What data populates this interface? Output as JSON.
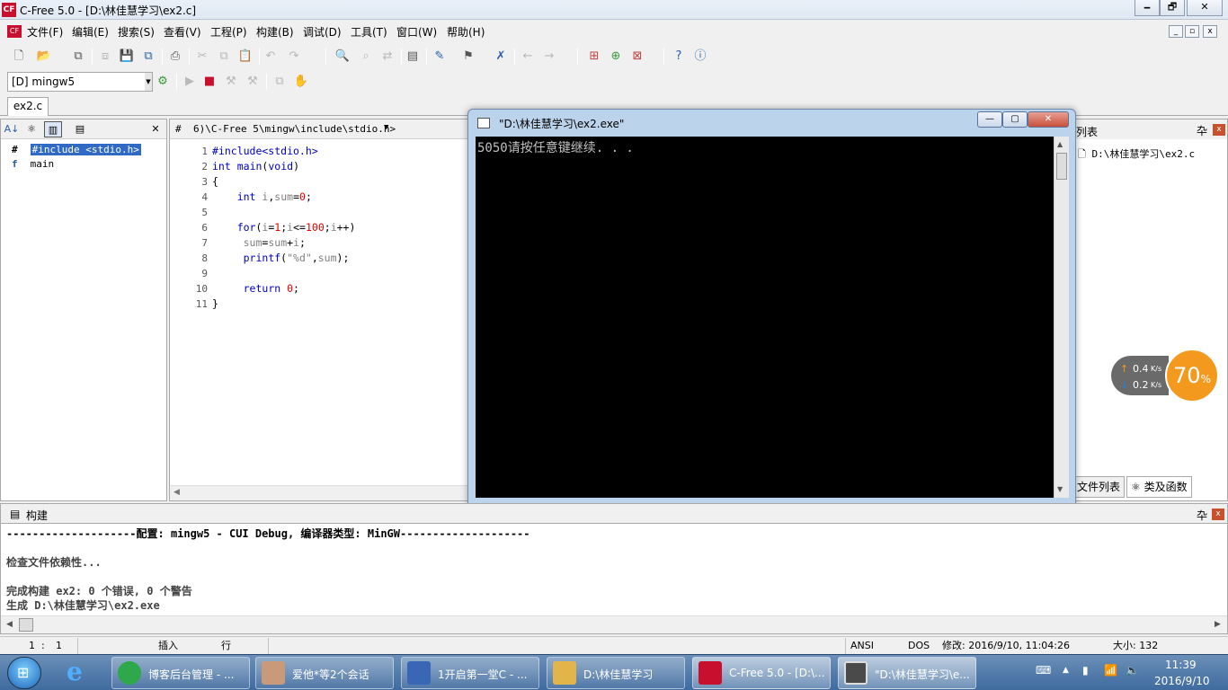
{
  "window": {
    "title": "C-Free 5.0 - [D:\\林佳慧学习\\ex2.c]",
    "minimize": "🗕",
    "restore": "🗗",
    "close": "✕"
  },
  "menu": {
    "items": [
      "文件(F)",
      "编辑(E)",
      "搜索(S)",
      "查看(V)",
      "工程(P)",
      "构建(B)",
      "调试(D)",
      "工具(T)",
      "窗口(W)",
      "帮助(H)"
    ]
  },
  "toolbar": {
    "compiler": "[D] mingw5"
  },
  "tabs": {
    "file_tab": "ex2.c"
  },
  "left_panel": {
    "items": [
      {
        "icon": "#",
        "label": "#include <stdio.h>"
      },
      {
        "icon": "f",
        "label": "main"
      }
    ]
  },
  "editor": {
    "header": "6)\\C-Free 5\\mingw\\include\\stdio.h>",
    "lines": [
      "1",
      "2",
      "3",
      "4",
      "5",
      "6",
      "7",
      "8",
      "9",
      "10",
      "11"
    ]
  },
  "right_panel": {
    "header": "列表",
    "pin": "卆",
    "close": "x",
    "file": "D:\\林佳慧学习\\ex2.c",
    "tab_files": "文件列表",
    "tab_classes": "类及函数"
  },
  "console": {
    "title": "\"D:\\林佳慧学习\\ex2.exe\"",
    "output": "5050请按任意键继续. . ."
  },
  "netmon": {
    "up": "0.4",
    "down": "0.2",
    "unit": "K/s",
    "percent": "70",
    "percent_sign": "%"
  },
  "build": {
    "title": "构建",
    "pin": "卆",
    "close": "x",
    "lines": [
      "--------------------配置: mingw5 - CUI Debug, 编译器类型: MinGW--------------------",
      "",
      "检查文件依赖性...",
      "",
      "完成构建 ex2: 0 个错误, 0 个警告",
      "生成 D:\\林佳慧学习\\ex2.exe"
    ]
  },
  "status": {
    "line": "1",
    "sep": ":",
    "col": "1",
    "insert": "插入",
    "row": "行",
    "encoding": "ANSI",
    "format": "DOS",
    "modified": "修改: 2016/9/10, 11:04:26",
    "size": "大小: 132"
  },
  "taskbar": {
    "tasks": [
      {
        "label": "博客后台管理 - ...",
        "color": "#2ea84a"
      },
      {
        "label": "爱他*等2个会话",
        "color": "#c89a7a"
      },
      {
        "label": "1开启第一堂C - ...",
        "color": "#3a67b5"
      },
      {
        "label": "D:\\林佳慧学习",
        "color": "#e2b54a"
      },
      {
        "label": "C-Free 5.0 - [D:\\...",
        "color": "#c8102e"
      },
      {
        "label": "\"D:\\林佳慧学习\\e...",
        "color": "#4a4a4a"
      }
    ],
    "time": "11:39",
    "date": "2016/9/10"
  }
}
